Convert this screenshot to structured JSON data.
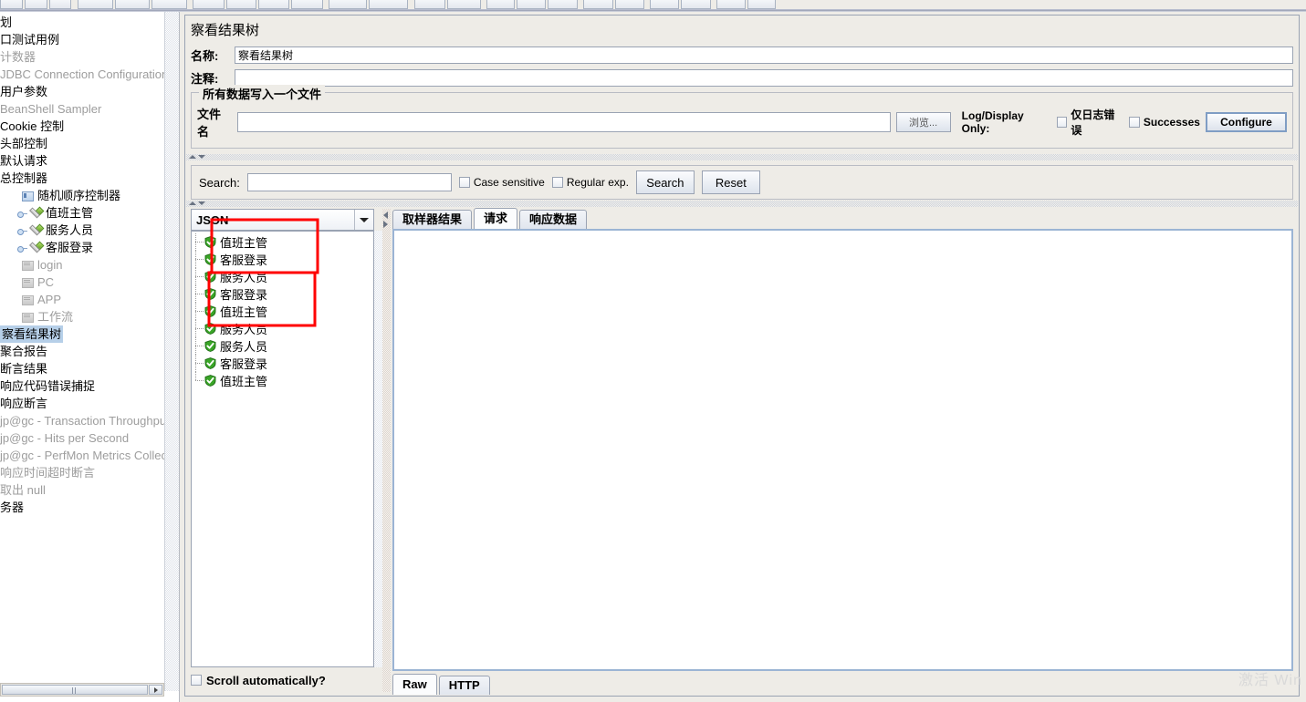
{
  "app": {
    "title": "察看结果树",
    "watermark": "激活 Win"
  },
  "sidebar": {
    "items": [
      {
        "label": "划",
        "icon": "none",
        "state": "normal",
        "indent": 0
      },
      {
        "label": "口测试用例",
        "icon": "none",
        "state": "normal",
        "indent": 0
      },
      {
        "label": "计数器",
        "icon": "none",
        "state": "dim",
        "indent": 0
      },
      {
        "label": "JDBC Connection Configuration",
        "icon": "none",
        "state": "dim",
        "indent": 0
      },
      {
        "label": "用户参数",
        "icon": "none",
        "state": "normal",
        "indent": 0
      },
      {
        "label": "BeanShell Sampler",
        "icon": "none",
        "state": "dim",
        "indent": 0
      },
      {
        "label": "Cookie 控制",
        "icon": "none",
        "state": "normal",
        "indent": 0
      },
      {
        "label": "头部控制",
        "icon": "none",
        "state": "normal",
        "indent": 0
      },
      {
        "label": "默认请求",
        "icon": "none",
        "state": "normal",
        "indent": 0
      },
      {
        "label": "总控制器",
        "icon": "none",
        "state": "normal",
        "indent": 0
      },
      {
        "label": "随机顺序控制器",
        "icon": "controller-icon",
        "state": "normal",
        "indent": 1
      },
      {
        "label": "值班主管",
        "icon": "sampler-pen-icon",
        "state": "normal",
        "indent": 2
      },
      {
        "label": "服务人员",
        "icon": "sampler-pen-icon",
        "state": "normal",
        "indent": 2
      },
      {
        "label": "客服登录",
        "icon": "sampler-pen-icon",
        "state": "normal",
        "indent": 2
      },
      {
        "label": "login",
        "icon": "disabled-element-icon",
        "state": "dim",
        "indent": 1
      },
      {
        "label": "PC",
        "icon": "disabled-element-icon",
        "state": "dim",
        "indent": 1
      },
      {
        "label": "APP",
        "icon": "disabled-element-icon",
        "state": "dim",
        "indent": 1
      },
      {
        "label": "工作流",
        "icon": "disabled-element-icon",
        "state": "dim",
        "indent": 1
      },
      {
        "label": "察看结果树",
        "icon": "none",
        "state": "selected",
        "indent": 0
      },
      {
        "label": "聚合报告",
        "icon": "none",
        "state": "normal",
        "indent": 0
      },
      {
        "label": "断言结果",
        "icon": "none",
        "state": "normal",
        "indent": 0
      },
      {
        "label": "响应代码错误捕捉",
        "icon": "none",
        "state": "normal",
        "indent": 0
      },
      {
        "label": "响应断言",
        "icon": "none",
        "state": "normal",
        "indent": 0
      },
      {
        "label": "jp@gc - Transaction Throughput vs",
        "icon": "none",
        "state": "dim",
        "indent": 0
      },
      {
        "label": "jp@gc - Hits per Second",
        "icon": "none",
        "state": "dim",
        "indent": 0
      },
      {
        "label": "jp@gc - PerfMon Metrics Collector",
        "icon": "none",
        "state": "dim",
        "indent": 0
      },
      {
        "label": "响应时间超时断言",
        "icon": "none",
        "state": "dim",
        "indent": 0
      },
      {
        "label": "取出 null",
        "icon": "none",
        "state": "dim",
        "indent": 0
      },
      {
        "label": "务器",
        "icon": "none",
        "state": "normal",
        "indent": 0
      }
    ]
  },
  "editor": {
    "title": "察看结果树",
    "name_label": "名称:",
    "name_value": "察看结果树",
    "comment_label": "注释:",
    "comment_value": "",
    "group_title": "所有数据写入一个文件",
    "filename_label": "文件名",
    "filename_value": "",
    "browse_label": "浏览...",
    "log_display_only_label": "Log/Display Only:",
    "errors_only_label": "仅日志错误",
    "successes_label": "Successes",
    "configure_label": "Configure"
  },
  "search": {
    "label": "Search:",
    "value": "",
    "case_sensitive_label": "Case sensitive",
    "regular_exp_label": "Regular exp.",
    "search_button": "Search",
    "reset_button": "Reset"
  },
  "results": {
    "renderer_selected": "JSON",
    "scroll_automatically_label": "Scroll automatically?",
    "nodes": [
      {
        "label": "值班主管",
        "status": "success"
      },
      {
        "label": "客服登录",
        "status": "success"
      },
      {
        "label": "服务人员",
        "status": "success"
      },
      {
        "label": "客服登录",
        "status": "success"
      },
      {
        "label": "值班主管",
        "status": "success"
      },
      {
        "label": "服务人员",
        "status": "success"
      },
      {
        "label": "服务人员",
        "status": "success"
      },
      {
        "label": "客服登录",
        "status": "success"
      },
      {
        "label": "值班主管",
        "status": "success"
      }
    ],
    "annotation_color": "#ff0000"
  },
  "detail": {
    "tabs": [
      {
        "label": "取样器结果",
        "active": false
      },
      {
        "label": "请求",
        "active": true
      },
      {
        "label": "响应数据",
        "active": false
      }
    ],
    "body_text": "",
    "bottom_tabs": [
      {
        "label": "Raw",
        "active": true
      },
      {
        "label": "HTTP",
        "active": false
      }
    ]
  }
}
